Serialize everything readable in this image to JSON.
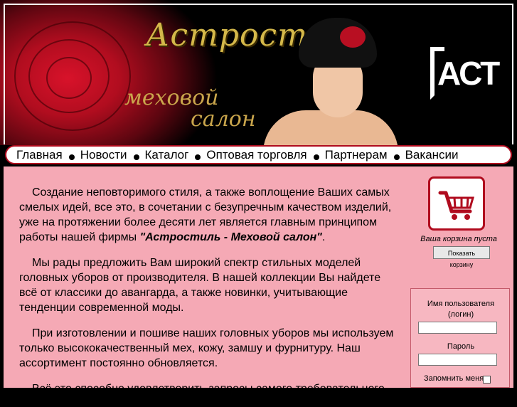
{
  "header": {
    "title": "Астростиль",
    "subtitle_line1": "меховой",
    "subtitle_line2": "салон",
    "logo_text": "АСТ"
  },
  "nav": {
    "items": [
      "Главная",
      "Новости",
      "Каталог",
      "Оптовая торговля",
      "Партнерам",
      "Вакансии"
    ]
  },
  "main": {
    "p1_text": "Создание неповторимого стиля, а также воплощение Ваших самых смелых идей, все это, в сочетании с безупречным качеством изделий, уже на протяжении более десяти лет является главным принципом работы нашей фирмы ",
    "p1_brand": "\"Астростиль - Меховой салон\"",
    "p1_end": ".",
    "p2": "Мы рады предложить Вам широкий спектр стильных моделей головных уборов от производителя. В нашей коллекции Вы найдете всё от классики до авангарда, а также новинки, учитывающие тенденции современной моды.",
    "p3": "При изготовлении и пошиве наших головных уборов мы используем только высококачественный мех, кожу, замшу и фурнитуру. Наш ассортимент постоянно обновляется.",
    "p4": "Всё это способно удовлетворить запросы самого требовательного"
  },
  "cart": {
    "status": "Ваша корзина пуста",
    "button": "Показать корзину",
    "icon": "shopping-cart-icon"
  },
  "login": {
    "username_label_line1": "Имя пользователя",
    "username_label_line2": "(логин)",
    "password_label": "Пароль",
    "remember_label": "Запомнить меня"
  },
  "colors": {
    "accent": "#b00b1e",
    "content_bg": "#f5a9b5",
    "header_bg": "#000000"
  }
}
